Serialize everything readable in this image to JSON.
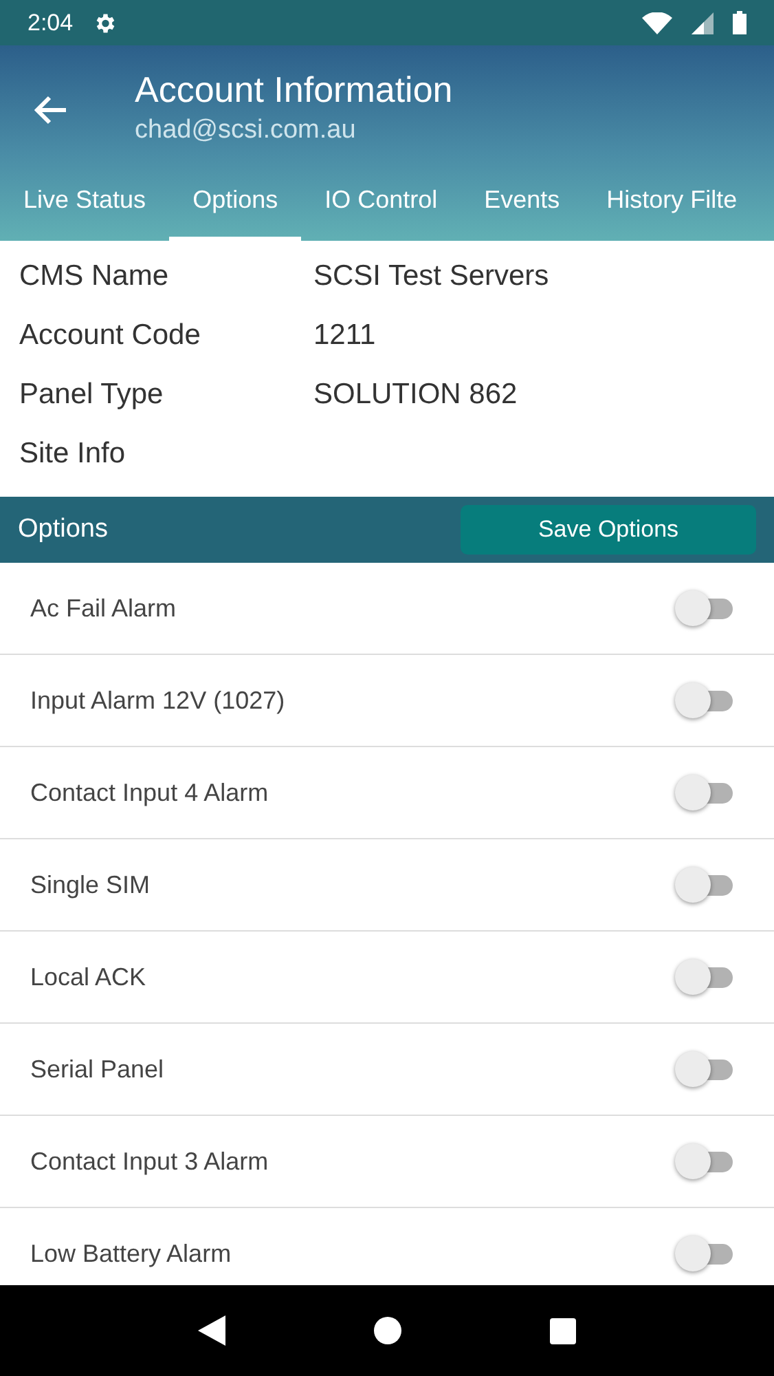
{
  "status_bar": {
    "time": "2:04"
  },
  "app_bar": {
    "title": "Account Information",
    "subtitle": "chad@scsi.com.au"
  },
  "tabs": [
    {
      "label": "Live Status",
      "selected": false
    },
    {
      "label": "Options",
      "selected": true
    },
    {
      "label": "IO Control",
      "selected": false
    },
    {
      "label": "Events",
      "selected": false
    },
    {
      "label": "History Filte",
      "selected": false
    }
  ],
  "info": [
    {
      "label": "CMS Name",
      "value": "SCSI Test Servers"
    },
    {
      "label": "Account Code",
      "value": "1211"
    },
    {
      "label": "Panel Type",
      "value": "SOLUTION 862"
    },
    {
      "label": "Site Info"
    }
  ],
  "options_header": {
    "title": "Options",
    "button": "Save Options"
  },
  "options": [
    {
      "label": "Ac Fail Alarm",
      "on": false
    },
    {
      "label": "Input Alarm 12V (1027)",
      "on": false
    },
    {
      "label": "Contact Input 4 Alarm",
      "on": false
    },
    {
      "label": "Single SIM",
      "on": false
    },
    {
      "label": "Local ACK",
      "on": false
    },
    {
      "label": "Serial Panel",
      "on": false
    },
    {
      "label": "Contact Input 3 Alarm",
      "on": false
    },
    {
      "label": "Low Battery Alarm",
      "on": false
    }
  ]
}
